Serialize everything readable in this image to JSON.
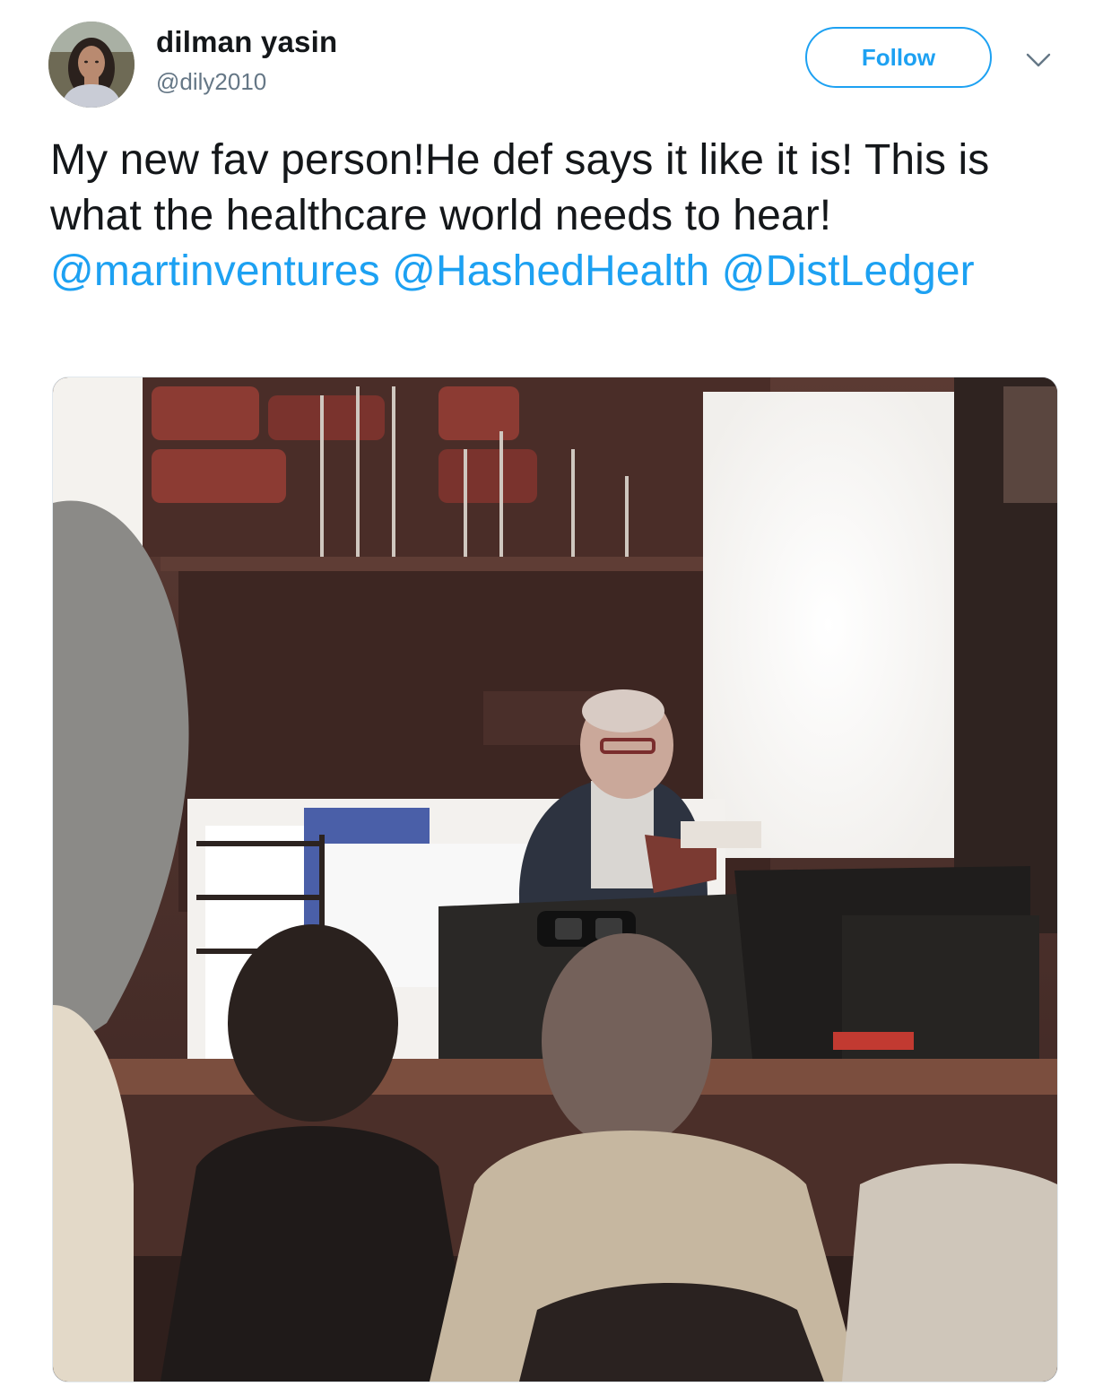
{
  "user": {
    "display_name": "dilman yasin",
    "handle": "@dily2010",
    "avatar_icon": "avatar-photo"
  },
  "actions": {
    "follow_label": "Follow",
    "more_icon": "chevron-down-icon"
  },
  "tweet": {
    "text_before": "My new fav person!He def says it like it is! This is what the healthcare world needs to hear! ",
    "mentions": [
      "@martinventures",
      "@HashedHealth",
      "@DistLedger"
    ]
  },
  "media": {
    "type": "photo"
  },
  "colors": {
    "accent": "#1da1f2",
    "text": "#14171a",
    "secondary": "#657786"
  }
}
